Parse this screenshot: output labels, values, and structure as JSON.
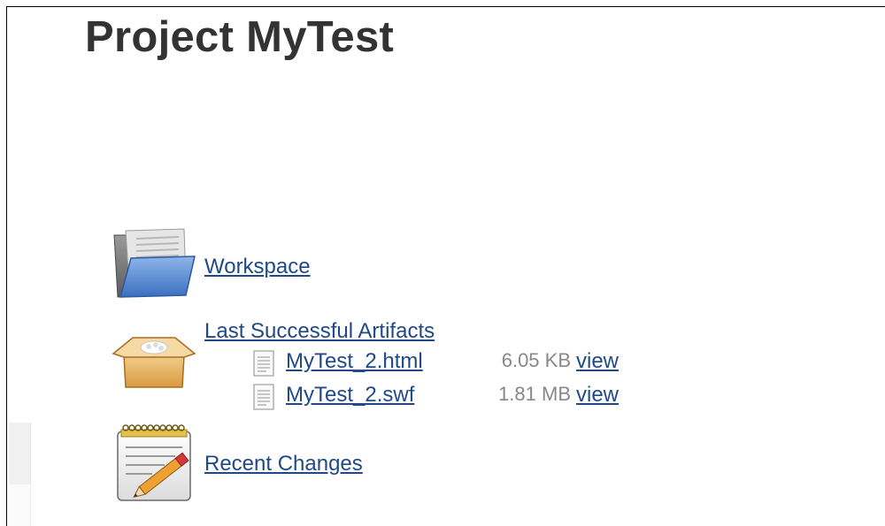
{
  "page": {
    "title": "Project MyTest"
  },
  "tasks": {
    "workspace": {
      "label": "Workspace",
      "icon": "folder-icon"
    },
    "artifacts": {
      "label": "Last Successful Artifacts",
      "icon": "package-box-icon",
      "files": [
        {
          "name": "MyTest_2.html",
          "size": "6.05 KB",
          "view_label": "view",
          "icon": "text-file-icon"
        },
        {
          "name": "MyTest_2.swf",
          "size": "1.81 MB",
          "view_label": "view",
          "icon": "text-file-icon"
        }
      ]
    },
    "recent_changes": {
      "label": "Recent Changes",
      "icon": "notepad-pencil-icon"
    }
  },
  "colors": {
    "title": "#333333",
    "link": "#204a87",
    "size_text": "#888888"
  }
}
